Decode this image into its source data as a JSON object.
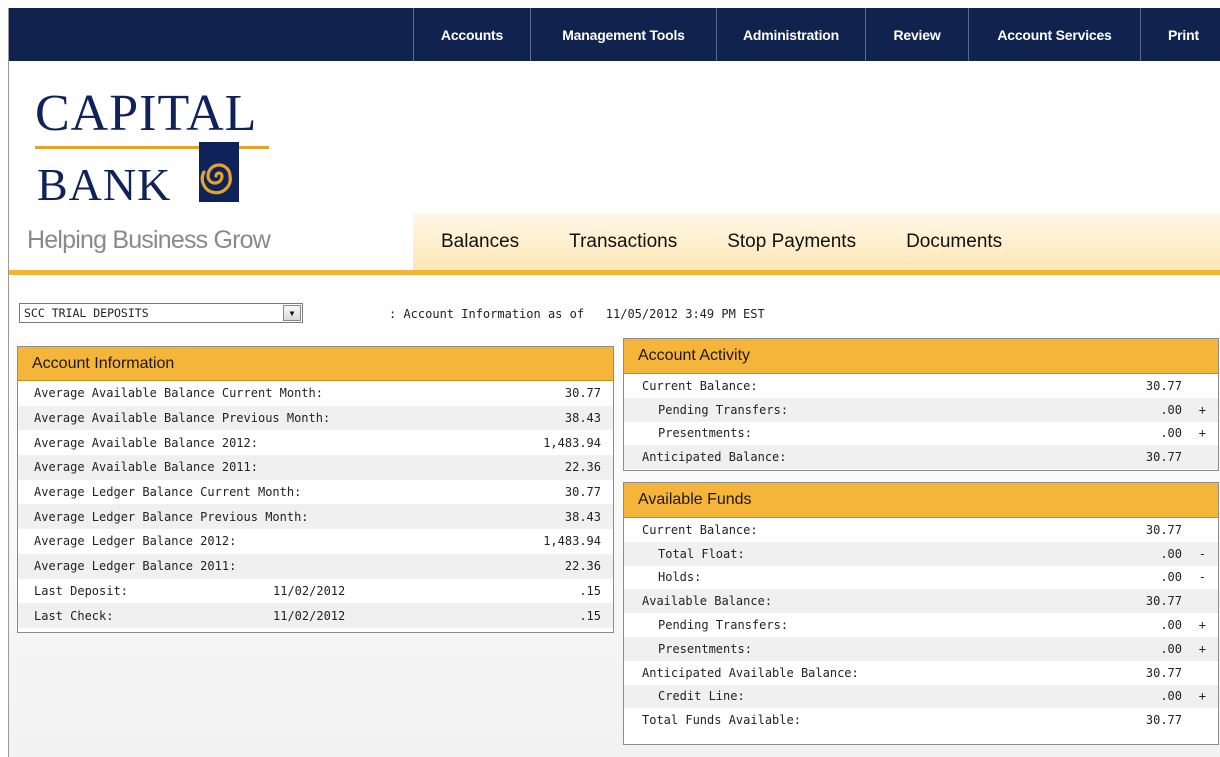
{
  "topnav": {
    "items": [
      "Accounts",
      "Management Tools",
      "Administration",
      "Review",
      "Account Services",
      "Print"
    ]
  },
  "logo": {
    "line1": "CAPITAL",
    "line2": "BANK",
    "tagline": "Helping Business Grow"
  },
  "subnav": {
    "items": [
      "Balances",
      "Transactions",
      "Stop Payments",
      "Documents"
    ]
  },
  "account_select": {
    "value": "SCC TRIAL DEPOSITS"
  },
  "as_of": {
    "label": ":  Account Information as of",
    "value": "11/05/2012 3:49 PM EST"
  },
  "account_information": {
    "title": "Account Information",
    "rows": [
      {
        "label": "Average Available Balance Current Month:",
        "value": "30.77"
      },
      {
        "label": "Average Available Balance Previous Month:",
        "value": "38.43"
      },
      {
        "label": "Average Available Balance  2012:",
        "value": "1,483.94"
      },
      {
        "label": "Average Available Balance  2011:",
        "value": "22.36"
      },
      {
        "label": "Average Ledger Balance Current Month:",
        "value": "30.77"
      },
      {
        "label": "Average Ledger Balance Previous Month:",
        "value": "38.43"
      },
      {
        "label": "Average Ledger Balance  2012:",
        "value": "1,483.94"
      },
      {
        "label": "Average Ledger Balance  2011:",
        "value": "22.36"
      },
      {
        "label": "Last Deposit:",
        "date": "11/02/2012",
        "value": ".15"
      },
      {
        "label": "Last Check:",
        "date": "11/02/2012",
        "value": ".15"
      }
    ]
  },
  "account_activity": {
    "title": "Account Activity",
    "rows": [
      {
        "label": "Current Balance:",
        "value": "30.77",
        "sign": ""
      },
      {
        "label": "Pending Transfers:",
        "value": ".00",
        "sign": "+"
      },
      {
        "label": "Presentments:",
        "value": ".00",
        "sign": "+"
      },
      {
        "label": "Anticipated Balance:",
        "value": "30.77",
        "sign": ""
      }
    ]
  },
  "available_funds": {
    "title": "Available Funds",
    "rows": [
      {
        "label": "Current Balance:",
        "value": "30.77",
        "sign": ""
      },
      {
        "label": "Total Float:",
        "value": ".00",
        "sign": "-"
      },
      {
        "label": "Holds:",
        "value": ".00",
        "sign": "-"
      },
      {
        "label": "Available Balance:",
        "value": "30.77",
        "sign": ""
      },
      {
        "label": "Pending Transfers:",
        "value": ".00",
        "sign": "+"
      },
      {
        "label": "Presentments:",
        "value": ".00",
        "sign": "+"
      },
      {
        "label": "Anticipated Available Balance:",
        "value": "30.77",
        "sign": ""
      },
      {
        "label": "Credit Line:",
        "value": ".00",
        "sign": "+"
      },
      {
        "label": "Total Funds Available:",
        "value": "30.77",
        "sign": ""
      }
    ]
  },
  "colors": {
    "nav": "#10234f",
    "accent": "#f5b43a",
    "logo_gold": "#e2a52a"
  }
}
